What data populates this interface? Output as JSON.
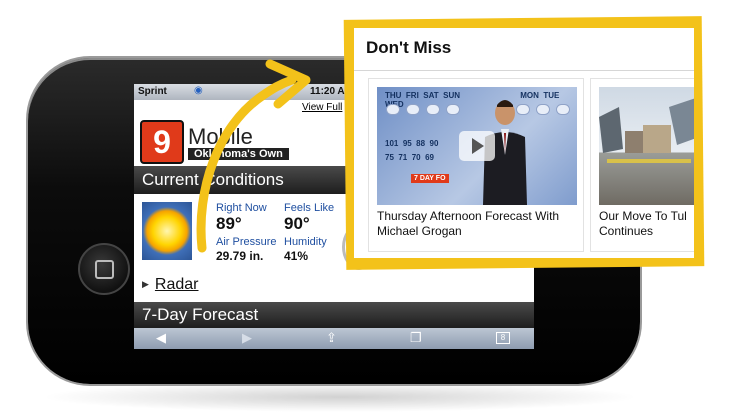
{
  "status": {
    "carrier": "Sprint",
    "time": "11:20 A"
  },
  "browser": {
    "view_full": "View Full"
  },
  "app": {
    "logo_number": "9",
    "brand": "Mobile",
    "tagline": "Oklahoma's Own"
  },
  "conditions": {
    "header": "Current Conditions",
    "right_now_label": "Right Now",
    "right_now_value": "89°",
    "feels_like_label": "Feels Like",
    "feels_like_value": "90°",
    "air_pressure_label": "Air Pressure",
    "air_pressure_value": "29.79 in.",
    "humidity_label": "Humidity",
    "humidity_value": "41%"
  },
  "radar": {
    "label": "Radar"
  },
  "forecast": {
    "header": "7-Day Forecast"
  },
  "toolbar": {
    "tabs_count": "8"
  },
  "dont_miss": {
    "title": "Don't Miss",
    "items": [
      {
        "caption_line1": "Thursday Afternoon Forecast With",
        "caption_line2": "Michael Grogan",
        "thumb": {
          "days": [
            "THU",
            "FRI",
            "SAT",
            "SUN",
            "MON",
            "TUE",
            "WED"
          ],
          "row1": [
            "101",
            "95",
            "88",
            "90"
          ],
          "row2": [
            "75",
            "71",
            "70",
            "69"
          ],
          "tag": "7 DAY FO"
        }
      },
      {
        "caption_line1": "Our Move To Tul",
        "caption_line2": "Continues"
      }
    ]
  },
  "colors": {
    "accent_yellow": "#f3c21a",
    "brand_red": "#e03a1a"
  }
}
